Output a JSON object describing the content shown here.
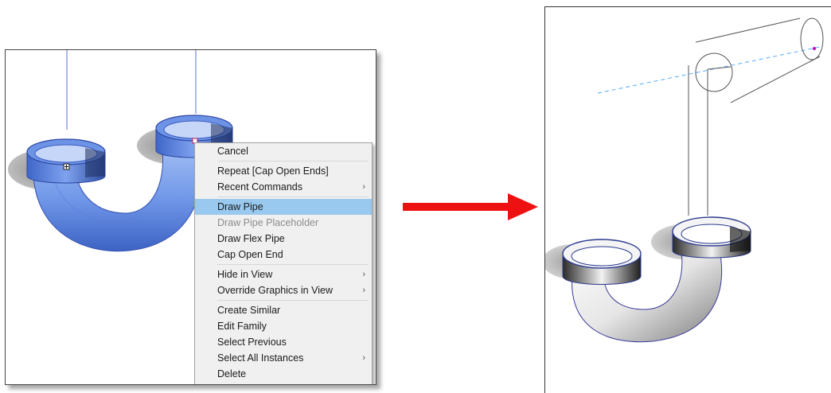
{
  "context_menu": {
    "items": [
      {
        "label": "Cancel",
        "submenu": false,
        "disabled": false,
        "highlighted": false
      },
      {
        "separator": true
      },
      {
        "label": "Repeat [Cap Open Ends]",
        "submenu": false,
        "disabled": false,
        "highlighted": false
      },
      {
        "label": "Recent Commands",
        "submenu": true,
        "disabled": false,
        "highlighted": false
      },
      {
        "separator": true
      },
      {
        "label": "Draw Pipe",
        "submenu": false,
        "disabled": false,
        "highlighted": true
      },
      {
        "label": "Draw Pipe Placeholder",
        "submenu": false,
        "disabled": true,
        "highlighted": false
      },
      {
        "label": "Draw Flex Pipe",
        "submenu": false,
        "disabled": false,
        "highlighted": false
      },
      {
        "label": "Cap Open End",
        "submenu": false,
        "disabled": false,
        "highlighted": false
      },
      {
        "separator": true
      },
      {
        "label": "Hide in View",
        "submenu": true,
        "disabled": false,
        "highlighted": false
      },
      {
        "label": "Override Graphics in View",
        "submenu": true,
        "disabled": false,
        "highlighted": false
      },
      {
        "separator": true
      },
      {
        "label": "Create Similar",
        "submenu": false,
        "disabled": false,
        "highlighted": false
      },
      {
        "label": "Edit Family",
        "submenu": false,
        "disabled": false,
        "highlighted": false
      },
      {
        "label": "Select Previous",
        "submenu": false,
        "disabled": false,
        "highlighted": false
      },
      {
        "label": "Select All Instances",
        "submenu": true,
        "disabled": false,
        "highlighted": false
      },
      {
        "label": "Delete",
        "submenu": false,
        "disabled": false,
        "highlighted": false
      }
    ],
    "submenu_glyph": "›"
  },
  "colors": {
    "selection_blue": "#4d7fe0",
    "highlight": "#99c9ef",
    "arrow_red": "#ee1111"
  },
  "icons": [
    "cursor-grip-icon",
    "submenu-arrow-icon",
    "pipe-trap-model-icon",
    "right-arrow-icon"
  ]
}
